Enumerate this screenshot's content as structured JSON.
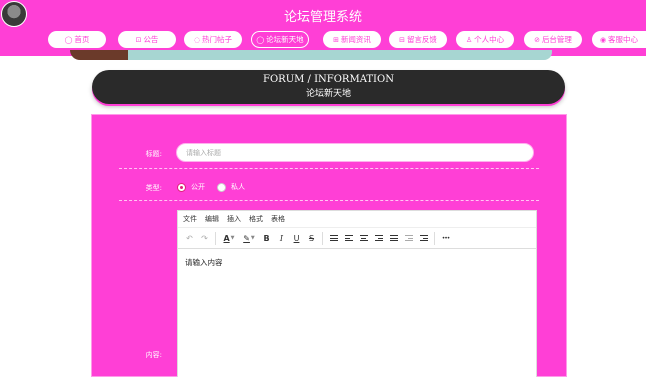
{
  "header": {
    "site_title": "论坛管理系统"
  },
  "nav": {
    "items": [
      {
        "label": "首页",
        "icon": "home-icon",
        "glyph": "◯"
      },
      {
        "label": "公告",
        "icon": "notice-icon",
        "glyph": "⊡"
      },
      {
        "label": "热门帖子",
        "icon": "hot-icon",
        "glyph": "◌"
      },
      {
        "label": "论坛新天地",
        "icon": "forum-icon",
        "glyph": "◯"
      },
      {
        "label": "新闻资讯",
        "icon": "news-icon",
        "glyph": "⊞"
      },
      {
        "label": "留言反馈",
        "icon": "message-icon",
        "glyph": "⊟"
      },
      {
        "label": "个人中心",
        "icon": "user-icon",
        "glyph": "♙"
      },
      {
        "label": "后台管理",
        "icon": "link-icon",
        "glyph": "⊘"
      },
      {
        "label": "客服中心",
        "icon": "support-icon",
        "glyph": "◉"
      }
    ],
    "active_index": 3
  },
  "section": {
    "title_en": "FORUM / INFORMATION",
    "title_cn": "论坛新天地"
  },
  "form": {
    "title_label": "标题:",
    "title_placeholder": "请输入标题",
    "type_label": "类型:",
    "type_options": [
      {
        "label": "公开",
        "checked": true
      },
      {
        "label": "私人",
        "checked": false
      }
    ],
    "content_label": "内容:"
  },
  "editor": {
    "menu": [
      "文件",
      "编辑",
      "插入",
      "格式",
      "表格"
    ],
    "toolbar": {
      "undo": "↶",
      "redo": "↷",
      "text_color": "A",
      "highlight": "✎",
      "bold": "B",
      "italic": "I",
      "underline": "U",
      "strike": "S",
      "more": "•••"
    },
    "placeholder_text": "请输入内容"
  },
  "colors": {
    "accent": "#ff3fd6",
    "dark_header": "#2a2a2a",
    "banner": "#a7d6d2"
  }
}
